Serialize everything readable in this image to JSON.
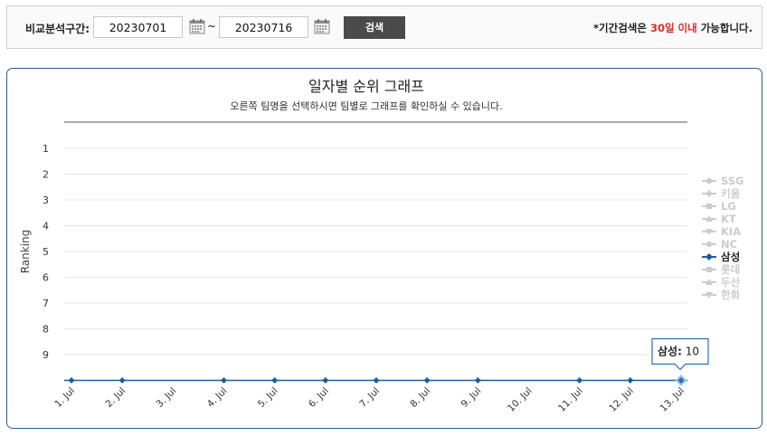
{
  "filter": {
    "label": "비교분석구간:",
    "start_date": "20230701",
    "tilde": "~",
    "end_date": "20230716",
    "search_label": "검색",
    "note_prefix": "*기간검색은 ",
    "note_highlight": "30일 이내",
    "note_suffix": " 가능합니다."
  },
  "colors": {
    "accent_line": "#1f5c99",
    "highlight_text": "#d32f2f",
    "inactive_legend": "#cccccc",
    "gridline": "#e6e6e6"
  },
  "chart_data": {
    "type": "line",
    "title": "일자별 순위 그래프",
    "subtitle": "오른쪽 팀명을 선택하시면 팀별로 그래프를 확인하실 수 있습니다.",
    "ylabel": "Ranking",
    "xlabel": "",
    "ylim": [
      1,
      10
    ],
    "y_reversed": true,
    "y_ticks": [
      "1",
      "2",
      "3",
      "4",
      "5",
      "6",
      "7",
      "8",
      "9"
    ],
    "x_categories": [
      "1. Jul",
      "2. Jul",
      "3. Jul",
      "4. Jul",
      "5. Jul",
      "6. Jul",
      "7. Jul",
      "8. Jul",
      "9. Jul",
      "10. Jul",
      "11. Jul",
      "12. Jul",
      "13. Jul"
    ],
    "series": [
      {
        "name": "삼성",
        "active": true,
        "values": [
          10,
          10,
          null,
          10,
          10,
          10,
          10,
          10,
          10,
          null,
          10,
          10,
          10
        ]
      }
    ],
    "legend": {
      "placement": "right",
      "items": [
        {
          "name": "SSG",
          "active": false,
          "marker": "circle"
        },
        {
          "name": "키움",
          "active": false,
          "marker": "diamond"
        },
        {
          "name": "LG",
          "active": false,
          "marker": "square"
        },
        {
          "name": "KT",
          "active": false,
          "marker": "triangle"
        },
        {
          "name": "KIA",
          "active": false,
          "marker": "triangle-down"
        },
        {
          "name": "NC",
          "active": false,
          "marker": "circle"
        },
        {
          "name": "삼성",
          "active": true,
          "marker": "diamond"
        },
        {
          "name": "롯데",
          "active": false,
          "marker": "square"
        },
        {
          "name": "두산",
          "active": false,
          "marker": "triangle"
        },
        {
          "name": "한화",
          "active": false,
          "marker": "triangle-down"
        }
      ]
    },
    "tooltip": {
      "series": "삼성",
      "value": "10",
      "category": "13. Jul"
    }
  }
}
